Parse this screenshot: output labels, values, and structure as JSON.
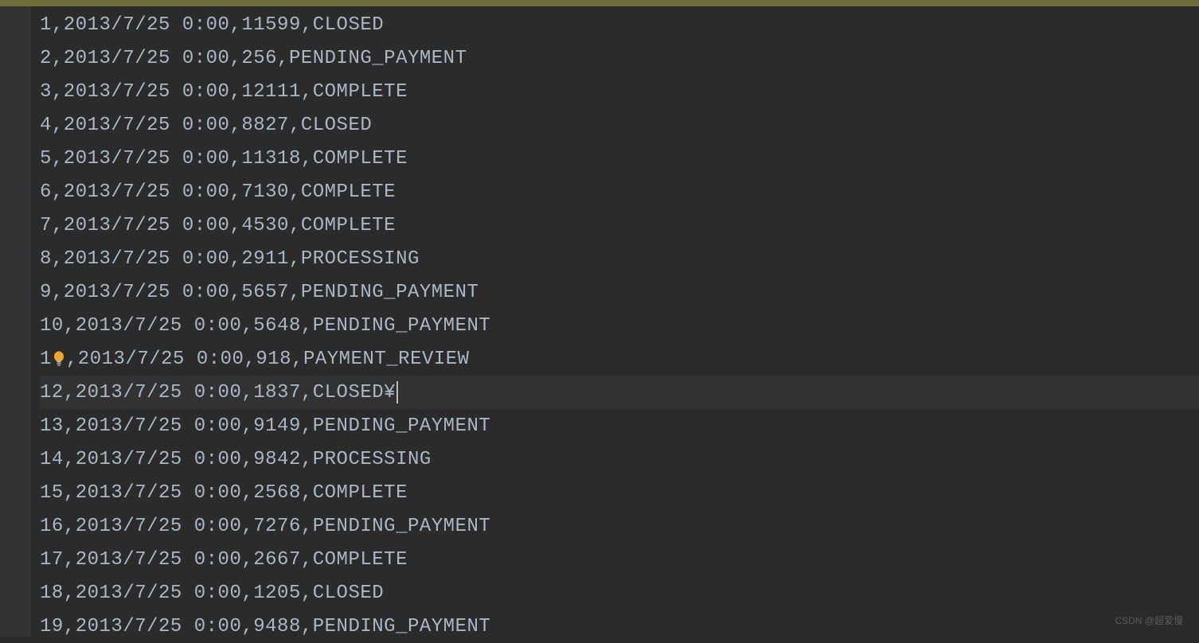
{
  "editor": {
    "lines": [
      {
        "text": "1,2013/7/25 0:00,11599,CLOSED",
        "current": false,
        "bulb": false
      },
      {
        "text": "2,2013/7/25 0:00,256,PENDING_PAYMENT",
        "current": false,
        "bulb": false
      },
      {
        "text": "3,2013/7/25 0:00,12111,COMPLETE",
        "current": false,
        "bulb": false
      },
      {
        "text": "4,2013/7/25 0:00,8827,CLOSED",
        "current": false,
        "bulb": false
      },
      {
        "text": "5,2013/7/25 0:00,11318,COMPLETE",
        "current": false,
        "bulb": false
      },
      {
        "text": "6,2013/7/25 0:00,7130,COMPLETE",
        "current": false,
        "bulb": false
      },
      {
        "text": "7,2013/7/25 0:00,4530,COMPLETE",
        "current": false,
        "bulb": false
      },
      {
        "text": "8,2013/7/25 0:00,2911,PROCESSING",
        "current": false,
        "bulb": false
      },
      {
        "text": "9,2013/7/25 0:00,5657,PENDING_PAYMENT",
        "current": false,
        "bulb": false
      },
      {
        "text": "10,2013/7/25 0:00,5648,PENDING_PAYMENT",
        "current": false,
        "bulb": false
      },
      {
        "text": "1 ,2013/7/25 0:00,918,PAYMENT_REVIEW",
        "current": false,
        "bulb": true,
        "prefix": "1",
        "suffix": ",2013/7/25 0:00,918,PAYMENT_REVIEW"
      },
      {
        "text": "12,2013/7/25 0:00,1837,CLOSED¥",
        "current": true,
        "bulb": false,
        "hasCaret": true,
        "beforeCaret": "12,2013/7/25 0:00,1837,CLOSED¥"
      },
      {
        "text": "13,2013/7/25 0:00,9149,PENDING_PAYMENT",
        "current": false,
        "bulb": false
      },
      {
        "text": "14,2013/7/25 0:00,9842,PROCESSING",
        "current": false,
        "bulb": false
      },
      {
        "text": "15,2013/7/25 0:00,2568,COMPLETE",
        "current": false,
        "bulb": false
      },
      {
        "text": "16,2013/7/25 0:00,7276,PENDING_PAYMENT",
        "current": false,
        "bulb": false
      },
      {
        "text": "17,2013/7/25 0:00,2667,COMPLETE",
        "current": false,
        "bulb": false
      },
      {
        "text": "18,2013/7/25 0:00,1205,CLOSED",
        "current": false,
        "bulb": false
      },
      {
        "text": "19,2013/7/25 0:00,9488,PENDING_PAYMENT",
        "current": false,
        "bulb": false
      }
    ]
  },
  "watermark": "CSDN @超爱慢"
}
